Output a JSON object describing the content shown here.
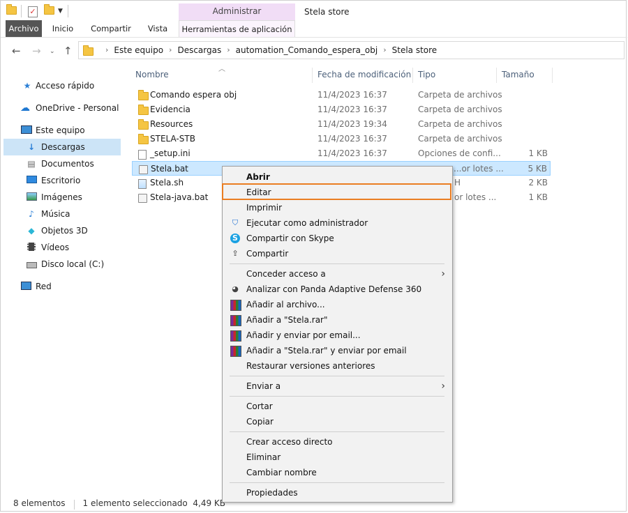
{
  "window": {
    "title": "Stela store",
    "manage_tab": "Administrar"
  },
  "ribbon": {
    "tabs": [
      "Archivo",
      "Inicio",
      "Compartir",
      "Vista",
      "Herramientas de aplicación"
    ]
  },
  "address": {
    "crumbs": [
      "Este equipo",
      "Descargas",
      "automation_Comando_espera_obj",
      "Stela store"
    ]
  },
  "nav": {
    "items": [
      {
        "label": "Acceso rápido",
        "icon": "star-icon"
      },
      {
        "label": "OneDrive - Personal",
        "icon": "cloud-icon"
      },
      {
        "label": "Este equipo",
        "icon": "computer-icon"
      },
      {
        "label": "Descargas",
        "icon": "download-icon"
      },
      {
        "label": "Documentos",
        "icon": "document-icon"
      },
      {
        "label": "Escritorio",
        "icon": "desktop-icon"
      },
      {
        "label": "Imágenes",
        "icon": "image-icon"
      },
      {
        "label": "Música",
        "icon": "music-icon"
      },
      {
        "label": "Objetos 3D",
        "icon": "cube-icon"
      },
      {
        "label": "Vídeos",
        "icon": "video-icon"
      },
      {
        "label": "Disco local (C:)",
        "icon": "drive-icon"
      },
      {
        "label": "Red",
        "icon": "network-icon"
      }
    ]
  },
  "list": {
    "columns": [
      "Nombre",
      "Fecha de modificación",
      "Tipo",
      "Tamaño"
    ],
    "rows": [
      {
        "name": "Comando espera obj",
        "date": "11/4/2023 16:37",
        "type": "Carpeta de archivos",
        "size": "",
        "icon": "folder-icon"
      },
      {
        "name": "Evidencia",
        "date": "11/4/2023 16:37",
        "type": "Carpeta de archivos",
        "size": "",
        "icon": "folder-icon"
      },
      {
        "name": "Resources",
        "date": "11/4/2023 19:34",
        "type": "Carpeta de archivos",
        "size": "",
        "icon": "folder-icon"
      },
      {
        "name": "STELA-STB",
        "date": "11/4/2023 16:37",
        "type": "Carpeta de archivos",
        "size": "",
        "icon": "folder-icon"
      },
      {
        "name": "_setup.ini",
        "date": "11/4/2023 16:37",
        "type": "Opciones de confi...",
        "size": "1 KB",
        "icon": "ini-file-icon"
      },
      {
        "name": "Stela.bat",
        "date": "",
        "type": "...or lotes ...",
        "size": "5 KB",
        "icon": "bat-file-icon"
      },
      {
        "name": "Stela.sh",
        "date": "",
        "type": "H",
        "size": "2 KB",
        "icon": "sh-file-icon"
      },
      {
        "name": "Stela-java.bat",
        "date": "",
        "type": "or lotes ...",
        "size": "1 KB",
        "icon": "bat-file-icon"
      }
    ]
  },
  "status": {
    "count": "8 elementos",
    "selection": "1 elemento seleccionado  4,49 KB"
  },
  "context_menu": {
    "items": [
      {
        "label": "Abrir",
        "bold": true
      },
      {
        "label": "Editar"
      },
      {
        "label": "Imprimir"
      },
      {
        "label": "Ejecutar como administrador",
        "icon": "shield-icon"
      },
      {
        "label": "Compartir con Skype",
        "icon": "skype-icon"
      },
      {
        "label": "Compartir",
        "icon": "share-icon"
      },
      {
        "label": "Conceder acceso a"
      },
      {
        "label": "Analizar con Panda Adaptive Defense 360",
        "icon": "panda-icon"
      },
      {
        "label": "Añadir al archivo...",
        "icon": "rar-icon"
      },
      {
        "label": "Añadir a \"Stela.rar\"",
        "icon": "rar-icon"
      },
      {
        "label": "Añadir y enviar por email...",
        "icon": "rar-icon"
      },
      {
        "label": "Añadir a \"Stela.rar\" y enviar por email",
        "icon": "rar-icon"
      },
      {
        "label": "Restaurar versiones anteriores"
      },
      {
        "label": "Enviar a"
      },
      {
        "label": "Cortar"
      },
      {
        "label": "Copiar"
      },
      {
        "label": "Crear acceso directo"
      },
      {
        "label": "Eliminar"
      },
      {
        "label": "Cambiar nombre"
      },
      {
        "label": "Propiedades"
      }
    ]
  },
  "colors": {
    "accent_highlight": "#ea7d22",
    "selection": "#cce8ff",
    "manage_tab": "#f1ddf6"
  }
}
